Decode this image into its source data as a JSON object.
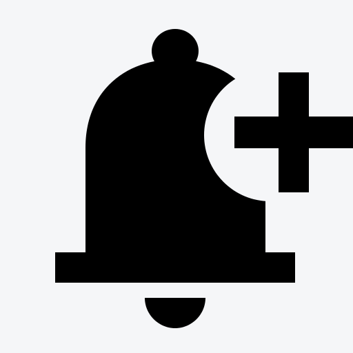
{
  "icon": {
    "name": "bell-plus-icon",
    "background_color": "#f5f6f8",
    "foreground_color": "#000000"
  }
}
